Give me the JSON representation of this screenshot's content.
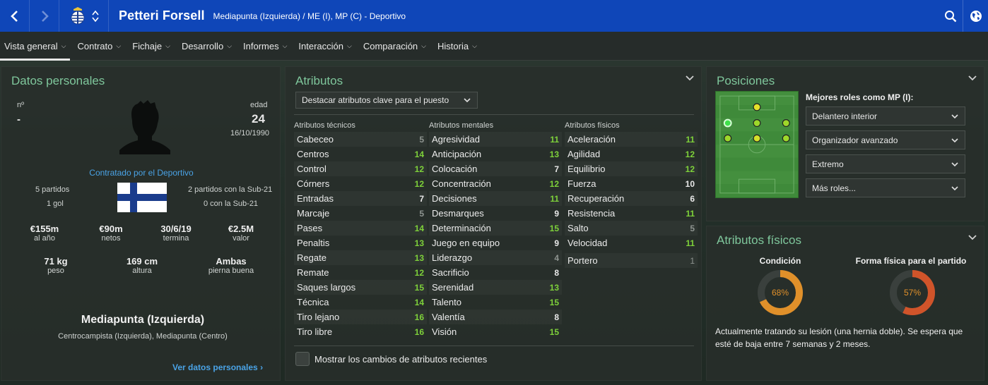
{
  "header": {
    "player_name": "Petteri Forsell",
    "position_line": "Mediapunta (Izquierda) / ME (I), MP (C) - Deportivo"
  },
  "menu": [
    {
      "label": "Vista general",
      "active": true
    },
    {
      "label": "Contrato"
    },
    {
      "label": "Fichaje"
    },
    {
      "label": "Desarrollo"
    },
    {
      "label": "Informes"
    },
    {
      "label": "Interacción"
    },
    {
      "label": "Comparación"
    },
    {
      "label": "Historia"
    }
  ],
  "personal": {
    "title": "Datos personales",
    "number_label": "nº",
    "number_value": "-",
    "age_label": "edad",
    "age_value": "24",
    "birthdate": "16/10/1990",
    "contracted_by": "Contratado por el Deportivo",
    "matches": "5 partidos",
    "goals": "1 gol",
    "u21_matches": "2 partidos con la Sub-21",
    "u21_goals": "0 con la Sub-21",
    "stats": [
      {
        "value": "€155m",
        "label": "al año"
      },
      {
        "value": "€90m",
        "label": "netos"
      },
      {
        "value": "30/6/19",
        "label": "termina"
      },
      {
        "value": "€2.5M",
        "label": "valor"
      }
    ],
    "body": [
      {
        "value": "71 kg",
        "label": "peso"
      },
      {
        "value": "169 cm",
        "label": "altura"
      },
      {
        "value": "Ambas",
        "label": "pierna buena"
      }
    ],
    "position_main": "Mediapunta (Izquierda)",
    "position_other": "Centrocampista (Izquierda), Mediapunta (Centro)",
    "more_link": "Ver datos personales"
  },
  "attributes": {
    "title": "Atributos",
    "highlight_select": "Destacar atributos clave para el puesto",
    "technical_head": "Atributos técnicos",
    "mental_head": "Atributos mentales",
    "physical_head": "Atributos físicos",
    "technical": [
      {
        "name": "Cabeceo",
        "value": "5",
        "tone": "d"
      },
      {
        "name": "Centros",
        "value": "14",
        "tone": "g"
      },
      {
        "name": "Control",
        "value": "12",
        "tone": "g"
      },
      {
        "name": "Córners",
        "value": "12",
        "tone": "g"
      },
      {
        "name": "Entradas",
        "value": "7",
        "tone": "w"
      },
      {
        "name": "Marcaje",
        "value": "5",
        "tone": "d"
      },
      {
        "name": "Pases",
        "value": "14",
        "tone": "g"
      },
      {
        "name": "Penaltis",
        "value": "13",
        "tone": "g"
      },
      {
        "name": "Regate",
        "value": "13",
        "tone": "g"
      },
      {
        "name": "Remate",
        "value": "12",
        "tone": "g"
      },
      {
        "name": "Saques largos",
        "value": "15",
        "tone": "g"
      },
      {
        "name": "Técnica",
        "value": "14",
        "tone": "g"
      },
      {
        "name": "Tiro lejano",
        "value": "16",
        "tone": "g"
      },
      {
        "name": "Tiro libre",
        "value": "16",
        "tone": "g"
      }
    ],
    "mental": [
      {
        "name": "Agresividad",
        "value": "11",
        "tone": "g"
      },
      {
        "name": "Anticipación",
        "value": "13",
        "tone": "g"
      },
      {
        "name": "Colocación",
        "value": "7",
        "tone": "w"
      },
      {
        "name": "Concentración",
        "value": "12",
        "tone": "g"
      },
      {
        "name": "Decisiones",
        "value": "11",
        "tone": "g"
      },
      {
        "name": "Desmarques",
        "value": "9",
        "tone": "w"
      },
      {
        "name": "Determinación",
        "value": "15",
        "tone": "g"
      },
      {
        "name": "Juego en equipo",
        "value": "9",
        "tone": "w"
      },
      {
        "name": "Liderazgo",
        "value": "4",
        "tone": "d"
      },
      {
        "name": "Sacrificio",
        "value": "8",
        "tone": "w"
      },
      {
        "name": "Serenidad",
        "value": "13",
        "tone": "g"
      },
      {
        "name": "Talento",
        "value": "15",
        "tone": "g"
      },
      {
        "name": "Valentía",
        "value": "8",
        "tone": "w"
      },
      {
        "name": "Visión",
        "value": "15",
        "tone": "g"
      }
    ],
    "physical": [
      {
        "name": "Aceleración",
        "value": "11",
        "tone": "g"
      },
      {
        "name": "Agilidad",
        "value": "12",
        "tone": "g"
      },
      {
        "name": "Equilibrio",
        "value": "12",
        "tone": "g"
      },
      {
        "name": "Fuerza",
        "value": "10",
        "tone": "w"
      },
      {
        "name": "Recuperación",
        "value": "6",
        "tone": "w"
      },
      {
        "name": "Resistencia",
        "value": "11",
        "tone": "g"
      },
      {
        "name": "Salto",
        "value": "5",
        "tone": "d"
      },
      {
        "name": "Velocidad",
        "value": "11",
        "tone": "g"
      }
    ],
    "goalkeeper": {
      "name": "Portero",
      "value": "1"
    },
    "recent_changes_label": "Mostrar los cambios de atributos recientes"
  },
  "positions": {
    "title": "Posiciones",
    "roles_head": "Mejores roles como MP (I):",
    "roles": [
      "Delantero interior",
      "Organizador avanzado",
      "Extremo",
      "Más roles..."
    ]
  },
  "physical": {
    "title": "Atributos físicos",
    "condition_label": "Condición",
    "condition_pct": "68%",
    "condition_value": 68,
    "fitness_label": "Forma física para el partido",
    "fitness_pct": "57%",
    "fitness_value": 57,
    "injury_text": "Actualmente tratando su lesión (una hernia doble). Se espera que esté de baja entre 7 semanas y 2 meses."
  },
  "colors": {
    "header_blue": "#0f46b8",
    "accent_green": "#7fc79c",
    "good_value": "#7ed13a",
    "condition_ring": "#e0902a",
    "fitness_ring": "#d0542a",
    "link_blue": "#4aa3e6"
  }
}
